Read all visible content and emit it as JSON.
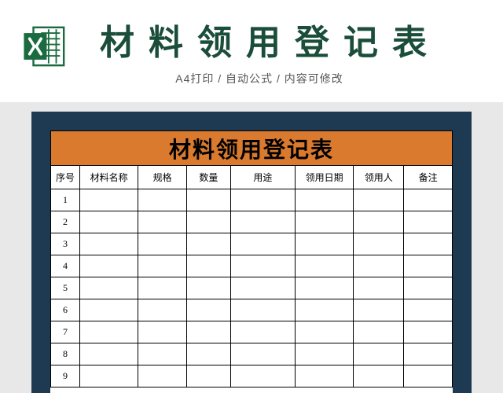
{
  "header": {
    "title": "材料领用登记表",
    "subtitle_parts": [
      "A4打印",
      "自动公式",
      "内容可修改"
    ],
    "subtitle_sep": " / "
  },
  "doc": {
    "title": "材料领用登记表",
    "columns": [
      {
        "key": "seq",
        "label": "序号"
      },
      {
        "key": "name",
        "label": "材料名称"
      },
      {
        "key": "spec",
        "label": "规格"
      },
      {
        "key": "qty",
        "label": "数量"
      },
      {
        "key": "use",
        "label": "用途"
      },
      {
        "key": "date",
        "label": "领用日期"
      },
      {
        "key": "person",
        "label": "领用人"
      },
      {
        "key": "note",
        "label": "备注"
      }
    ],
    "rows": [
      {
        "seq": "1",
        "name": "",
        "spec": "",
        "qty": "",
        "use": "",
        "date": "",
        "person": "",
        "note": ""
      },
      {
        "seq": "2",
        "name": "",
        "spec": "",
        "qty": "",
        "use": "",
        "date": "",
        "person": "",
        "note": ""
      },
      {
        "seq": "3",
        "name": "",
        "spec": "",
        "qty": "",
        "use": "",
        "date": "",
        "person": "",
        "note": ""
      },
      {
        "seq": "4",
        "name": "",
        "spec": "",
        "qty": "",
        "use": "",
        "date": "",
        "person": "",
        "note": ""
      },
      {
        "seq": "5",
        "name": "",
        "spec": "",
        "qty": "",
        "use": "",
        "date": "",
        "person": "",
        "note": ""
      },
      {
        "seq": "6",
        "name": "",
        "spec": "",
        "qty": "",
        "use": "",
        "date": "",
        "person": "",
        "note": ""
      },
      {
        "seq": "7",
        "name": "",
        "spec": "",
        "qty": "",
        "use": "",
        "date": "",
        "person": "",
        "note": ""
      },
      {
        "seq": "8",
        "name": "",
        "spec": "",
        "qty": "",
        "use": "",
        "date": "",
        "person": "",
        "note": ""
      },
      {
        "seq": "9",
        "name": "",
        "spec": "",
        "qty": "",
        "use": "",
        "date": "",
        "person": "",
        "note": ""
      }
    ]
  },
  "colors": {
    "brand_green": "#1a4d3a",
    "frame_navy": "#1e3a52",
    "title_orange": "#d97a2e"
  }
}
